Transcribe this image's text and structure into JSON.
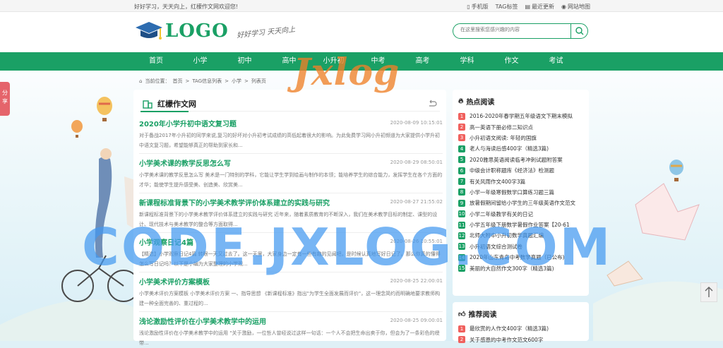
{
  "topbar": {
    "welcome": "好好学习，天天向上，红檬作文网欢迎您!",
    "links": [
      "手机版",
      "TAG标签",
      "最近更新",
      "网站地图"
    ]
  },
  "header": {
    "logo_text": "LOGO",
    "slogan": "好好学习 天天向上",
    "search_placeholder": "在这里搜索您感兴趣的内容"
  },
  "nav": [
    "首页",
    "小学",
    "初中",
    "高中",
    "小升初",
    "中考",
    "高考",
    "学科",
    "作文",
    "考试"
  ],
  "breadcrumb": {
    "prefix": "当前位置：",
    "items": [
      "首页",
      "TAG信息列表",
      "小学",
      "列表页"
    ],
    "sep": ">"
  },
  "main": {
    "title": "红檬作文网",
    "articles": [
      {
        "title": "2020年小学升初中语文复习题",
        "date": "2020-08-09 10:15:01",
        "summary": "对于备战2017年小升初的同学来说,复习的好坏对小升初考试成绩的高低起着很大的影响。为此免费学习网小升初频道为大家提供小学升初中语文复习题，希望能够真正的帮助到家长和..."
      },
      {
        "title": "小学美术课的教学反思怎么写",
        "date": "2020-08-29 08:50:01",
        "summary": "小学美术课的教学反思怎么写 美术是一门特别的学科，它能让学生学到绘画与制作的本领；能培养学生的综合能力，发挥学生在各个方面的才华；能使学生提升感受美、创造美、欣赏美..."
      },
      {
        "title": "新课程标准背景下的小学美术教学评价体系建立的实践与研究",
        "date": "2020-08-27 21:55:02",
        "summary": "新课程标准背景下的小学美术教学评价体系建立的实践与研究 近年来，随着素质教育的不断深入，我们在美术教学目标的制定、课型的设计、现代技术与美术教学的整合等方面取得..."
      },
      {
        "title": "小学观察日记4篇",
        "date": "2020-08-26 10:55:01",
        "summary": "【精选】小学观察日记4篇 转眼一天又过去了。这一天里，大家身边一定有一些有趣的见闻吧，是时候认真地写好日记了。那么你真的懂得怎么写日记吗？以下是小编为大家整理的小学观..."
      },
      {
        "title": "小学美术评价方案模板",
        "date": "2020-08-25 22:00:01",
        "summary": "小学美术评价方案模板 小学美术评价方案 一、指导思想 《新课程标准》指出\"为学生全面发展而评价\"，这一理念简约而明确地要求教师构建一种全面完善的、重过程的..."
      },
      {
        "title": "浅论激励性评价在小学美术教学中的运用",
        "date": "2020-08-25 09:00:01",
        "summary": "浅论激励性评价在小学美术教学中的运用 \"关于激励，一位哲人曾经说过这样一句话：一个人不会把生命出卖于你，但会为了一条彩色的绶带..."
      }
    ]
  },
  "hot": {
    "title": "热点阅读",
    "items": [
      "2016-2020年春学期五年级语文下期末模拟",
      "高一英语下册必修二知识点",
      "小升初语文阅读: 年轻的国旗",
      "老人与海读后感400字（精选3篇)",
      "2020雅思英语阅读临考冲刺试题附答案",
      "中级会计职称题库《经济法》检测题",
      "有关风雨作文400字3篇",
      "小学一年级寒假数学口算练习题三篇",
      "放暑假期间留给小学生的三年级英语作文范文",
      "小学二年级教学有关的日记",
      "小学五年级下册数学暑假作业答案【20-61",
      "北师大附中小升初数学真题汇编",
      "小升初语文综合测试卷",
      "2020年山东青岛中考数学真题（已公布)",
      "美丽的大自然作文300字（精选3篇)"
    ],
    "badge_colors": [
      "#f0605d",
      "#f0605d",
      "#f0605d",
      "#1aa065",
      "#1aa065",
      "#1aa065",
      "#1aa065",
      "#1aa065",
      "#1aa065",
      "#1aa065",
      "#1aa065",
      "#1aa065",
      "#1aa065",
      "#1aa065",
      "#1aa065"
    ]
  },
  "recommend": {
    "title": "推荐阅读",
    "items": [
      "最欣赏的人作文400字（精选3篇)",
      "关于感恩的中考作文范文600字"
    ]
  },
  "share_label": "分享",
  "watermarks": {
    "top": "Jxlog",
    "big": "CODE.JXLOG.COM"
  },
  "colors": {
    "accent": "#1aa065",
    "hot": "#f0605d",
    "watermark_blue": "#4299f0",
    "watermark_orange": "#ee8028"
  }
}
